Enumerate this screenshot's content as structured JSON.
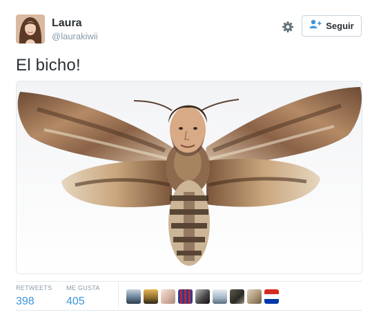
{
  "user": {
    "name": "Laura",
    "handle": "@laurakiwii"
  },
  "actions": {
    "follow_label": "Seguir",
    "follow_icon": "add-user-icon",
    "settings_icon": "gear-icon"
  },
  "tweet": {
    "text": "El bicho!"
  },
  "stats": {
    "retweets_label": "RETWEETS",
    "retweets_value": "398",
    "likes_label": "ME GUSTA",
    "likes_value": "405"
  },
  "colors": {
    "link_blue": "#3b94d9",
    "muted_gray": "#8899a6",
    "text_dark": "#292f33",
    "border": "#e1e8ed"
  }
}
